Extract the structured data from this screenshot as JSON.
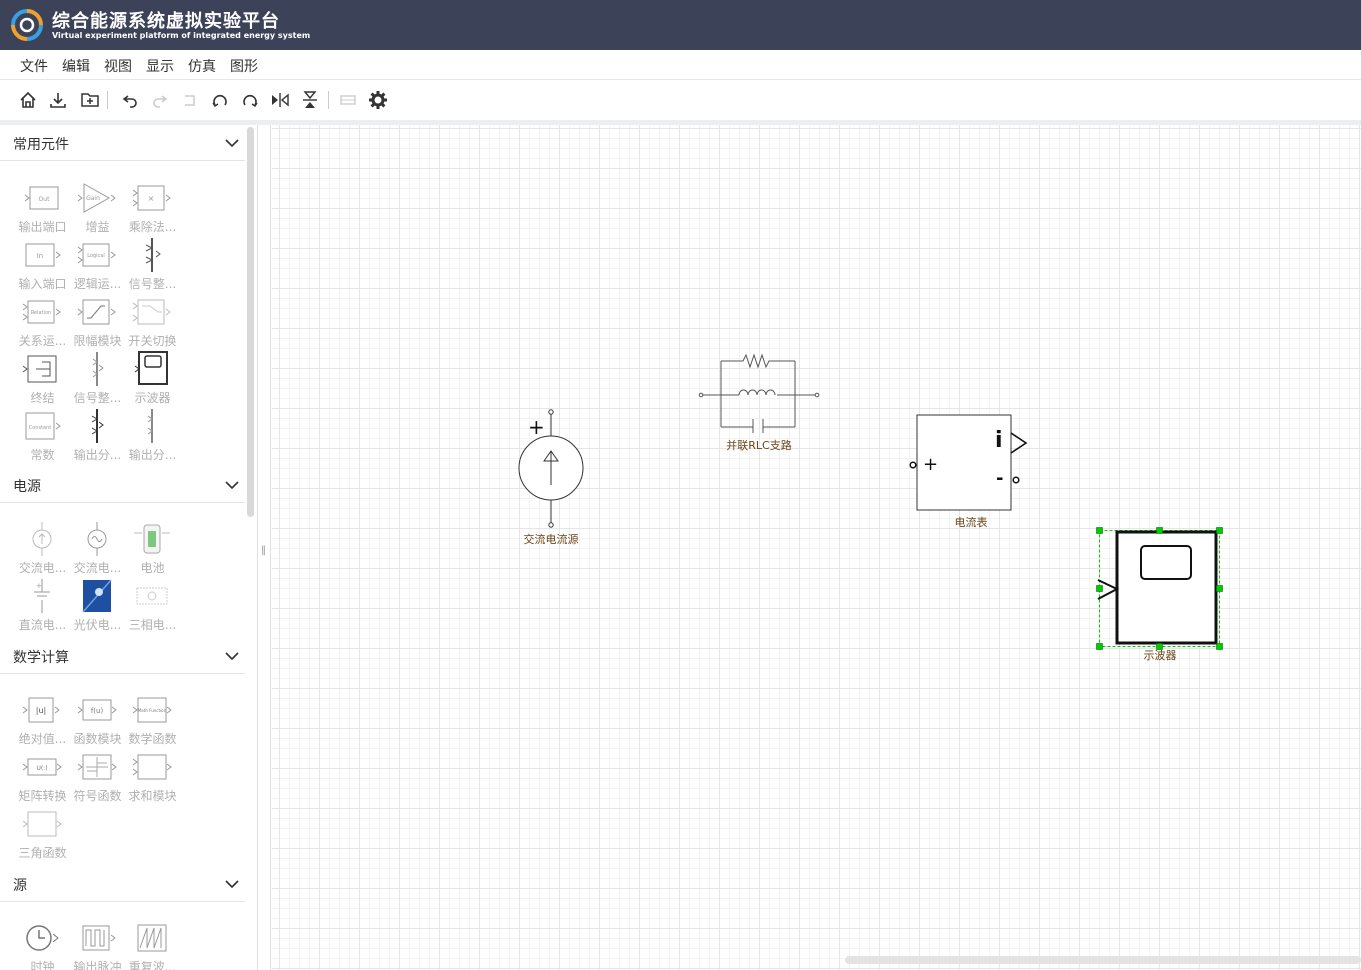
{
  "header": {
    "title": "综合能源系统虚拟实验平台",
    "subtitle": "Virtual experiment platform of integrated energy system"
  },
  "menu": [
    "文件",
    "编辑",
    "视图",
    "显示",
    "仿真",
    "图形"
  ],
  "toolbar": {
    "buttons": [
      "home-icon",
      "download-icon",
      "new-folder-icon",
      "undo-icon",
      "redo-icon",
      "delete-icon",
      "rotate-left-icon",
      "rotate-right-icon",
      "flip-horizontal-icon",
      "flip-vertical-icon",
      "grid-icon",
      "settings-icon"
    ]
  },
  "sidebar": {
    "sections": [
      {
        "title": "常用元件",
        "items": [
          {
            "label": "输出端口",
            "icon_text": "Out"
          },
          {
            "label": "增益",
            "icon_text": "Gain"
          },
          {
            "label": "乘除法...",
            "icon_text": "×"
          },
          {
            "label": "输入端口",
            "icon_text": "In"
          },
          {
            "label": "逻辑运...",
            "icon_text": "Logical"
          },
          {
            "label": "信号整..."
          },
          {
            "label": "关系运...",
            "icon_text": "Relation"
          },
          {
            "label": "限幅模块"
          },
          {
            "label": "开关切换"
          },
          {
            "label": "终结"
          },
          {
            "label": "信号整..."
          },
          {
            "label": "示波器"
          },
          {
            "label": "常数",
            "icon_text": "Constant"
          },
          {
            "label": "输出分..."
          },
          {
            "label": "输出分..."
          }
        ]
      },
      {
        "title": "电源",
        "items": [
          {
            "label": "交流电..."
          },
          {
            "label": "交流电..."
          },
          {
            "label": "电池"
          },
          {
            "label": "直流电..."
          },
          {
            "label": "光伏电..."
          },
          {
            "label": "三相电..."
          }
        ]
      },
      {
        "title": "数学计算",
        "items": [
          {
            "label": "绝对值...",
            "icon_text": "|u|"
          },
          {
            "label": "函数模块",
            "icon_text": "f(u)"
          },
          {
            "label": "数学函数",
            "icon_text": "Math Function"
          },
          {
            "label": "矩阵转换",
            "icon_text": "U(:)"
          },
          {
            "label": "符号函数"
          },
          {
            "label": "求和模块"
          },
          {
            "label": "三角函数"
          }
        ]
      },
      {
        "title": "源",
        "items": [
          {
            "label": "时钟"
          },
          {
            "label": "输出脉冲"
          },
          {
            "label": "重复波..."
          }
        ]
      }
    ]
  },
  "canvas": {
    "blocks": {
      "ac_source": {
        "label": "交流电流源",
        "plus": "+"
      },
      "rlc": {
        "label": "并联RLC支路"
      },
      "ammeter": {
        "label": "电流表",
        "i": "i",
        "plus": "+",
        "minus": "-"
      },
      "scope": {
        "label": "示波器"
      }
    }
  },
  "colors": {
    "header_bg": "#3c4358",
    "block_label": "#6a4416",
    "selection": "#00cc00"
  }
}
